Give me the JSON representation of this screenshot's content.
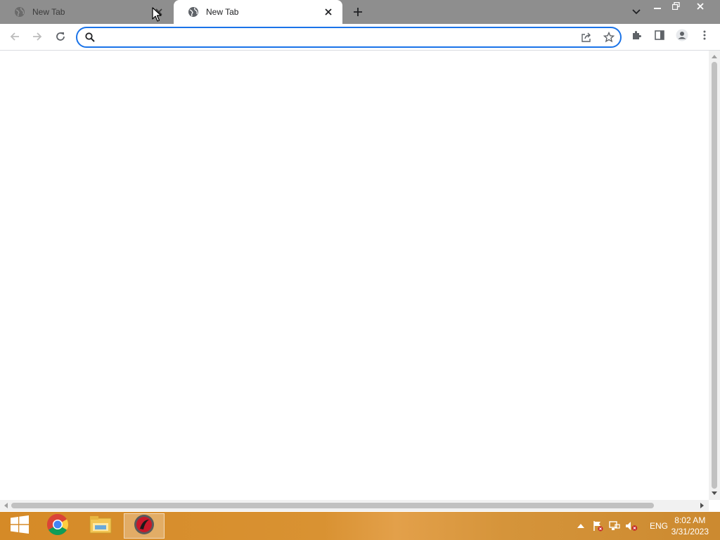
{
  "browser": {
    "tabs": [
      {
        "title": "New Tab",
        "active": false
      },
      {
        "title": "New Tab",
        "active": true
      }
    ],
    "omnibox": {
      "value": "",
      "placeholder": ""
    },
    "accent_color": "#1a73e8"
  },
  "taskbar": {
    "pinned": [
      "start-button",
      "chrome",
      "file-explorer",
      "app"
    ],
    "language": "ENG",
    "time": "8:02 AM",
    "date": "3/31/2023"
  }
}
